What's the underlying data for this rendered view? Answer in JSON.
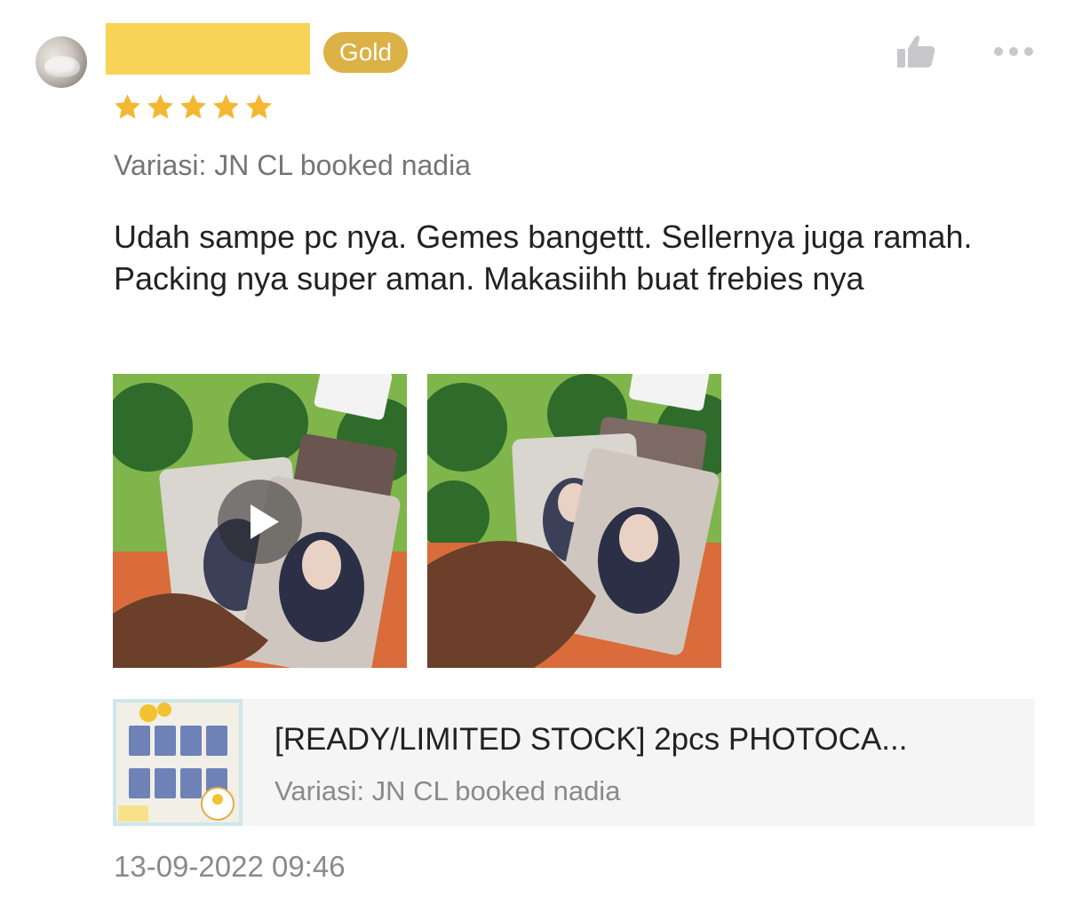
{
  "reviewer": {
    "badge": "Gold",
    "rating": 5
  },
  "review": {
    "variation": "Variasi: JN CL booked nadia",
    "text": "Udah sampe pc nya. Gemes bangettt. Sellernya juga ramah. Packing nya super aman. Makasiihh buat frebies nya",
    "timestamp": "13-09-2022 09:46"
  },
  "product": {
    "title": "[READY/LIMITED STOCK] 2pcs PHOTOCA...",
    "variation": "Variasi: JN CL booked nadia"
  },
  "icons": {
    "like": "thumbs-up-icon",
    "more": "more-horizontal-icon",
    "play": "play-icon",
    "star": "star-icon"
  },
  "colors": {
    "badge": "#dcb146",
    "star": "#f5b730",
    "username_mask": "#f7d358",
    "muted_text": "#8a8a8a"
  }
}
